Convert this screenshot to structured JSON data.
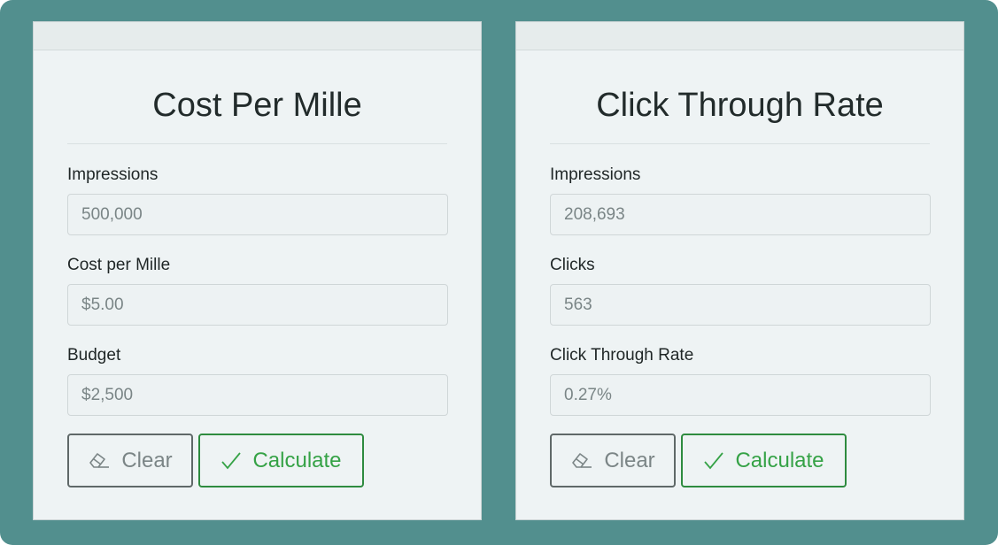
{
  "calculators": [
    {
      "title": "Cost Per Mille",
      "fields": [
        {
          "label": "Impressions",
          "value": "500,000"
        },
        {
          "label": "Cost per Mille",
          "value": "$5.00"
        },
        {
          "label": "Budget",
          "value": "$2,500"
        }
      ],
      "clear_label": "Clear",
      "calculate_label": "Calculate"
    },
    {
      "title": "Click Through Rate",
      "fields": [
        {
          "label": "Impressions",
          "value": "208,693"
        },
        {
          "label": "Clicks",
          "value": "563"
        },
        {
          "label": "Click Through Rate",
          "value": "0.27%"
        }
      ],
      "clear_label": "Clear",
      "calculate_label": "Calculate"
    }
  ],
  "icons": {
    "clear": "eraser-icon",
    "calculate": "checkmark-icon"
  },
  "colors": {
    "background": "#528f8e",
    "calculate_green": "#35a246",
    "clear_gray": "#5f6868"
  }
}
